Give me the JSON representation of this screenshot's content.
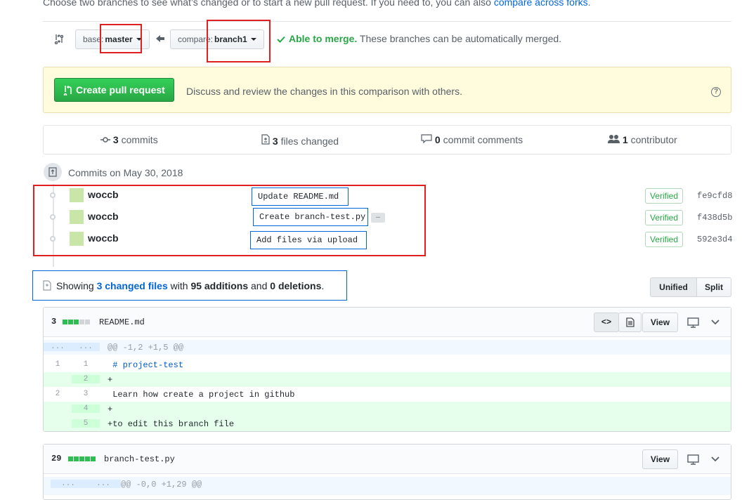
{
  "intro": {
    "text": "Choose two branches to see what’s changed or to start a new pull request. If you need to, you can also ",
    "link": "compare across forks",
    "end": "."
  },
  "range": {
    "base_prefix": "base:",
    "base_branch": "master",
    "compare_prefix": "compare:",
    "compare_branch": "branch1",
    "merge_status": "Able to merge.",
    "merge_detail": "These branches can be automatically merged."
  },
  "flash": {
    "button": "Create pull request",
    "text": "Discuss and review the changes in this comparison with others.",
    "help_glyph": "?"
  },
  "summary": {
    "commits_count": "3",
    "commits_label": "commits",
    "files_count": "3",
    "files_label": "files changed",
    "comments_count": "0",
    "comments_label": "commit comments",
    "contrib_count": "1",
    "contrib_label": "contributor"
  },
  "commits": {
    "date_heading": "Commits on May 30, 2018",
    "items": [
      {
        "author": "woccb",
        "message": "Update README.md",
        "badge": "Verified",
        "sha": "fe9cfd8"
      },
      {
        "author": "woccb",
        "message": "Create branch-test.py",
        "badge": "Verified",
        "sha": "f438d5b"
      },
      {
        "author": "woccb",
        "message": "Add files via upload",
        "badge": "Verified",
        "sha": "592e3d4"
      }
    ],
    "more_glyph": "…"
  },
  "diffbar": {
    "showing": "Showing",
    "changed_files": "3 changed files",
    "with": "with",
    "additions": "95 additions",
    "and": "and",
    "deletions": "0 deletions",
    "end": ".",
    "unified": "Unified",
    "split": "Split"
  },
  "files": [
    {
      "count": "3",
      "name": "README.md",
      "view": "View",
      "code_glyph": "<>",
      "lines": [
        {
          "n1": "...",
          "n2": "...",
          "code": "@@ -1,2 +1,5 @@"
        },
        {
          "n1": "1",
          "n2": "1",
          "code": " # project-test"
        },
        {
          "n1": "",
          "n2": "2",
          "code": "+"
        },
        {
          "n1": "2",
          "n2": "3",
          "code": " Learn how create a project in github"
        },
        {
          "n1": "",
          "n2": "4",
          "code": "+"
        },
        {
          "n1": "",
          "n2": "5",
          "code": "+to edit this branch file"
        }
      ]
    },
    {
      "count": "29",
      "name": "branch-test.py",
      "view": "View",
      "lines": [
        {
          "n1": "...",
          "n2": "...",
          "code": "@@ -0,0 +1,29 @@"
        }
      ]
    }
  ],
  "colors": {
    "green": "#28a745",
    "blue": "#0366d6",
    "annotation_red": "#e02020",
    "flash_bg": "#fffbdd"
  }
}
